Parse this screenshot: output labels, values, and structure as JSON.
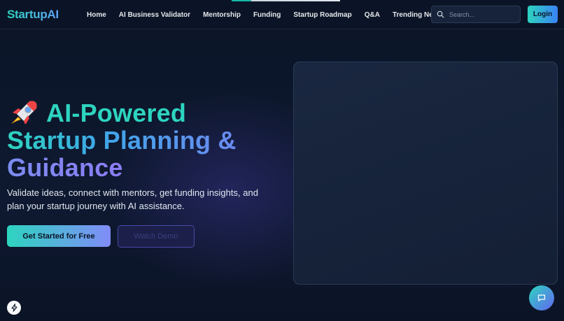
{
  "brand": {
    "name": "StartupAI"
  },
  "nav": {
    "links": [
      {
        "label": "Home"
      },
      {
        "label": "AI Business Validator"
      },
      {
        "label": "Mentorship"
      },
      {
        "label": "Funding"
      },
      {
        "label": "Startup Roadmap"
      },
      {
        "label": "Q&A"
      },
      {
        "label": "Trending News"
      }
    ]
  },
  "search": {
    "placeholder": "Search..."
  },
  "auth": {
    "login_label": "Login"
  },
  "hero": {
    "title_line1": "AI-Powered",
    "title_line2": "Startup Planning &",
    "title_line3": "Guidance",
    "rocket_icon": "rocket-icon",
    "subtitle": "Validate ideas, connect with mentors, get funding insights, and plan your startup journey with AI assistance.",
    "primary_cta": "Get Started for Free",
    "secondary_cta": "Watch Demo"
  },
  "icons": {
    "search": "search-icon",
    "chat": "chat-icon",
    "bolt": "bolt-icon"
  },
  "colors": {
    "background": "#0b1426",
    "accent_teal": "#2dd4bf",
    "accent_indigo": "#818cf8"
  }
}
